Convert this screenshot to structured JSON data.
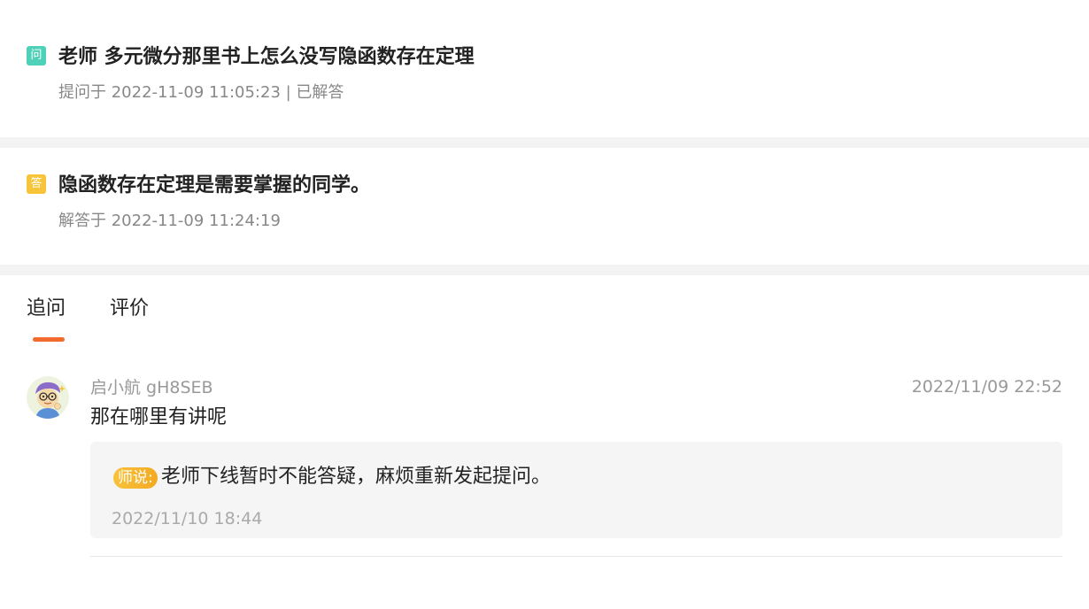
{
  "question": {
    "badge": "问",
    "title": "老师 多元微分那里书上怎么没写隐函数存在定理",
    "meta": "提问于 2022-11-09 11:05:23 | 已解答",
    "badge_color": "#4fd1b8"
  },
  "answer": {
    "badge": "答",
    "title": "隐函数存在定理是需要掌握的同学。",
    "meta": "解答于 2022-11-09 11:24:19",
    "badge_color": "#f7c43a"
  },
  "tabs": [
    {
      "label": "追问",
      "active": true
    },
    {
      "label": "评价",
      "active": false
    }
  ],
  "accent_color": "#f26a2e",
  "followup": {
    "avatar_icon": "cartoon-avatar-icon",
    "username": "启小航 gH8SEB",
    "time": "2022/11/09 22:52",
    "text": "那在哪里有讲呢",
    "reply": {
      "tag": "师说:",
      "text": "老师下线暂时不能答疑，麻烦重新发起提问。",
      "time": "2022/11/10 18:44"
    }
  }
}
